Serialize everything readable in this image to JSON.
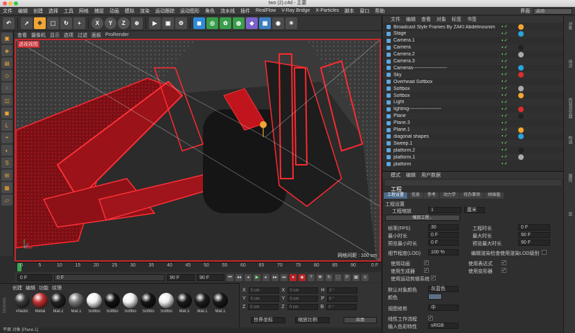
{
  "window": {
    "title": "two (2).c4d - 主要"
  },
  "menubar": {
    "items": [
      "文件",
      "编辑",
      "创建",
      "选择",
      "工具",
      "网格",
      "捕捉",
      "动画",
      "模拟",
      "渲染",
      "运动跟踪",
      "运动图形",
      "角色",
      "流水线",
      "插件",
      "RealFlow",
      "V-Ray Bridge",
      "X-Particles",
      "脚本",
      "窗口",
      "帮助"
    ],
    "layout_label": "界面:",
    "layout_value": "启动"
  },
  "toolbar": {
    "axis_x": "X",
    "axis_y": "Y",
    "axis_z": "Z"
  },
  "viewport": {
    "menu": [
      "查看",
      "摄像机",
      "显示",
      "选项",
      "过滤",
      "面板",
      "ProRender"
    ],
    "label": "透视视图",
    "grid_distance": "网格间距 : 100 cm",
    "accent": "#c9282e"
  },
  "timeline": {
    "ticks": [
      "0",
      "5",
      "10",
      "15",
      "20",
      "25",
      "30",
      "35",
      "40",
      "45",
      "50",
      "55",
      "60",
      "65",
      "70",
      "75",
      "80",
      "85",
      "90"
    ],
    "end_label": "0 F",
    "current_frame": "0 F",
    "start_field": "0 F",
    "end_field": "90 F",
    "max_field": "90 F"
  },
  "materials": {
    "menu": [
      "创建",
      "编辑",
      "功能",
      "纹理"
    ],
    "items": [
      {
        "label": "Plastic",
        "color": "#3a3a3a"
      },
      {
        "label": "Metal",
        "color": "#c43232"
      },
      {
        "label": "Mat.2",
        "color": "#222222"
      },
      {
        "label": "Mat.1",
        "color": "#777777"
      },
      {
        "label": "Softbo",
        "color": "#f2f2f2"
      },
      {
        "label": "Softbo",
        "color": "#111111"
      },
      {
        "label": "Softbo",
        "color": "#f0f0f0"
      },
      {
        "label": "Softbo",
        "color": "#151515"
      },
      {
        "label": "Softbo",
        "color": "#efefef"
      },
      {
        "label": "Mat.3",
        "color": "#1a1a1a"
      },
      {
        "label": "Mat.1",
        "color": "#1e1e1e"
      },
      {
        "label": "Mat.1",
        "color": "#191919"
      }
    ]
  },
  "coords": {
    "rows": [
      {
        "a": "X",
        "av": "0 cm",
        "b": "X",
        "bv": "0 cm",
        "c": "H",
        "cv": "0 °"
      },
      {
        "a": "Y",
        "av": "0 cm",
        "b": "Y",
        "bv": "0 cm",
        "c": "P",
        "cv": "0 °"
      },
      {
        "a": "Z",
        "av": "0 cm",
        "b": "Z",
        "bv": "0 cm",
        "c": "B",
        "cv": "0 °"
      }
    ],
    "mode1": "世界坐标",
    "mode2": "缩放比例",
    "apply": "应用"
  },
  "status": {
    "text": "平面 对象 [Plane.1]"
  },
  "objects": {
    "menu": [
      "文件",
      "编辑",
      "查看",
      "对象",
      "标签",
      "书签"
    ],
    "items": [
      "Broadcast Style Frames By ZAKI Abdelmounim",
      "Stage",
      "Camera.1",
      "Camera",
      "Camera.2",
      "Camera.3",
      "Cameras---------------------",
      "Sky",
      "Overhead Softbox",
      "Softbox",
      "Softbox",
      "Light",
      "lighting--------------------",
      "Plane",
      "Plane.3",
      "Plane.1",
      "diagonal shapes",
      "Sweep.1",
      "platform.2",
      "platform.1",
      "platform"
    ]
  },
  "attributes": {
    "menu": [
      "模式",
      "编辑",
      "用户数据"
    ],
    "section": "工程",
    "tabs": [
      "工程设置",
      "信息",
      "参考",
      "动力学",
      "待办事项",
      "帧插值"
    ],
    "heading": "工程设置",
    "scale_label": "工程缩放",
    "scale_value": "1",
    "scale_unit": "厘米",
    "scale_btn": "缩放工程...",
    "fps_label": "帧率(FPS)",
    "fps_value": "30",
    "duration_label": "工程时长",
    "duration_value": "0 F",
    "min_label": "最小时长",
    "min_value": "0 F",
    "max_label": "最大时长",
    "max_value": "90 F",
    "prev_min_label": "预览最小时长",
    "prev_min_value": "0 F",
    "prev_max_label": "预览最大时长",
    "prev_max_value": "90 F",
    "lod_label": "细节程度(LOD)",
    "lod_value": "100 %",
    "lod_render": "编辑渲染检查使用渲染LOD级别",
    "use_anim": "使用动画",
    "use_expr": "使用表达式",
    "use_gen": "使用生成器",
    "use_deform": "使用变形器",
    "use_motion": "使用运动剪辑系统",
    "def_color_label": "默认对象颜色",
    "def_color_value": "灰蓝色",
    "color_label": "颜色",
    "view_clip_label": "视图修剪",
    "view_clip_value": "中",
    "linear_label": "线性工作流程",
    "input_profile_label": "输入色彩特性",
    "input_profile_value": "sRGB"
  },
  "right_strip": [
    "对象",
    "场次",
    "内容浏览器",
    "构造",
    "属性",
    "层"
  ]
}
